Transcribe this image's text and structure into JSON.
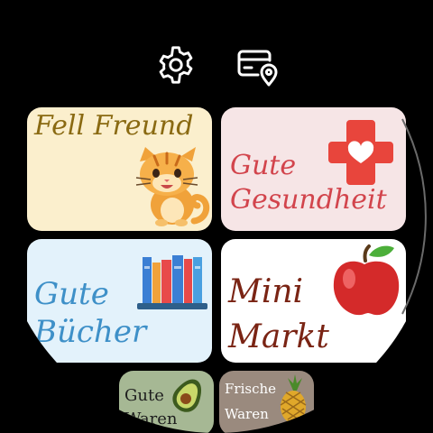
{
  "header": {
    "settings_icon": "gear-icon",
    "wallet_icon": "card-location-icon"
  },
  "tiles": [
    {
      "line1": "Fell Freund",
      "line2": "",
      "color": "#8a6a12",
      "bg": "#fbefcd",
      "icon": "cat-icon"
    },
    {
      "line1": "Gute",
      "line2": "Gesundheit",
      "color": "#d2444c",
      "bg": "#f6e5e6",
      "icon": "medical-cross-heart-icon"
    },
    {
      "line1": "Gute",
      "line2": "Bücher",
      "color": "#3e90c8",
      "bg": "#e3f2fb",
      "icon": "books-icon"
    },
    {
      "line1": "Mini",
      "line2": "Markt",
      "color": "#7a2414",
      "bg": "#ffffff",
      "icon": "apple-icon"
    },
    {
      "line1": "Gute",
      "line2": "Waren",
      "color": "#1e1e1e",
      "bg": "#a6b894",
      "icon": "avocado-icon"
    },
    {
      "line1": "Frische",
      "line2": "Waren",
      "color": "#ffffff",
      "bg": "#9a8a7e",
      "icon": "pineapple-icon"
    }
  ]
}
